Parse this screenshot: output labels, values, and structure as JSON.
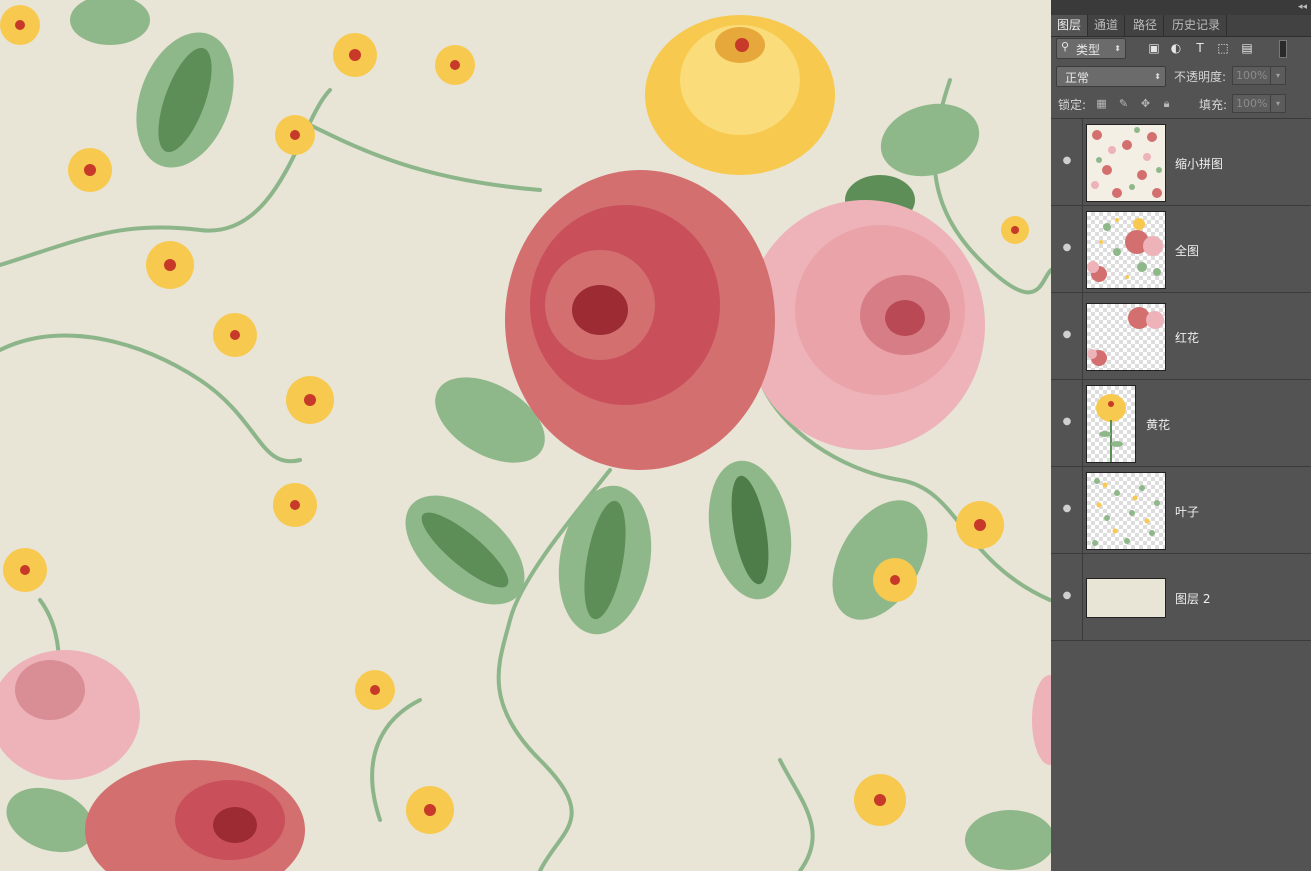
{
  "panel": {
    "tabs": [
      "图层",
      "通道",
      "路径",
      "历史记录"
    ],
    "filter": {
      "label": "类型",
      "icons": [
        "image-filter-icon",
        "adjustment-filter-icon",
        "type-filter-icon",
        "shape-filter-icon",
        "smart-object-filter-icon",
        "filter-toggle-icon"
      ]
    },
    "blend_mode": "正常",
    "opacity_label": "不透明度:",
    "opacity_value": "100%",
    "lock_label": "锁定:",
    "lock_icons": [
      "lock-transparent-icon",
      "lock-image-icon",
      "lock-position-icon",
      "lock-all-icon"
    ],
    "fill_label": "填充:",
    "fill_value": "100%"
  },
  "layers": [
    {
      "name": "缩小拼图",
      "visible": true,
      "thumb": "pattern-small"
    },
    {
      "name": "全图",
      "visible": true,
      "thumb": "pattern-full"
    },
    {
      "name": "红花",
      "visible": true,
      "thumb": "red-flowers"
    },
    {
      "name": "黄花",
      "visible": true,
      "thumb": "yellow-flower"
    },
    {
      "name": "叶子",
      "visible": true,
      "thumb": "leaves"
    },
    {
      "name": "图层 2",
      "visible": true,
      "thumb": "solid-cream"
    }
  ],
  "colors": {
    "canvas_bg": "#e8e4d6",
    "panel_bg": "#535353",
    "red_rose": "#d36f6f",
    "pink_rose": "#eeb3b8",
    "yellow_rose": "#f7c94f",
    "leaf": "#8fb88a",
    "dark_leaf": "#4e7d4a"
  }
}
